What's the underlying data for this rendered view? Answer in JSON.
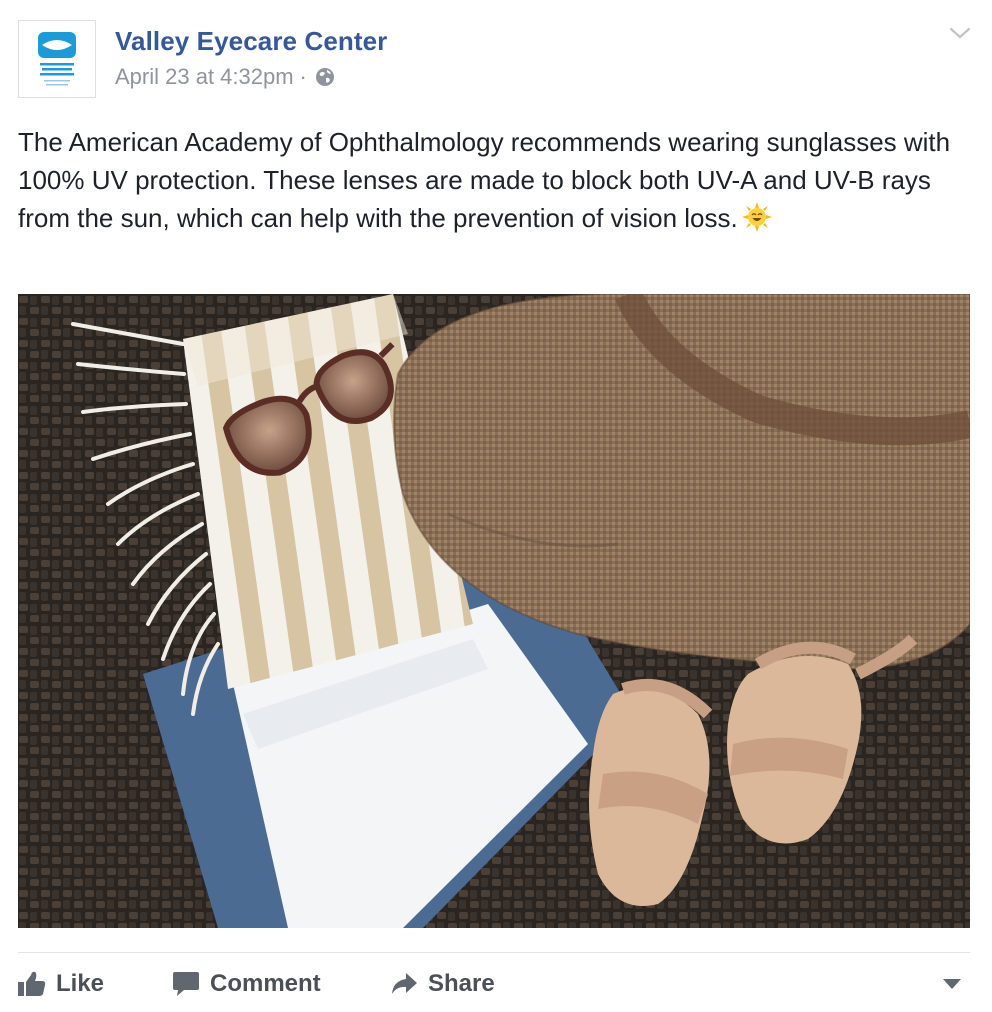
{
  "post": {
    "author": "Valley Eyecare Center",
    "timestamp": "April 23 at 4:32pm",
    "separator": "·",
    "privacy_icon": "globe-icon",
    "text": "The American Academy of Ophthalmology recommends wearing sunglasses with 100% UV protection. These lenses are made to block both UV-A and UV-B rays from the sun, which can help with the prevention of vision loss.",
    "emoji": "smiling-sun-emoji",
    "avatar_logo_text": "VALLEY EYECARE CENTER"
  },
  "actions": {
    "like_label": "Like",
    "comment_label": "Comment",
    "share_label": "Share"
  },
  "colors": {
    "link_blue": "#365899",
    "meta_gray": "#90949c",
    "action_gray": "#4b4f56",
    "logo_blue": "#1e9ad6"
  }
}
